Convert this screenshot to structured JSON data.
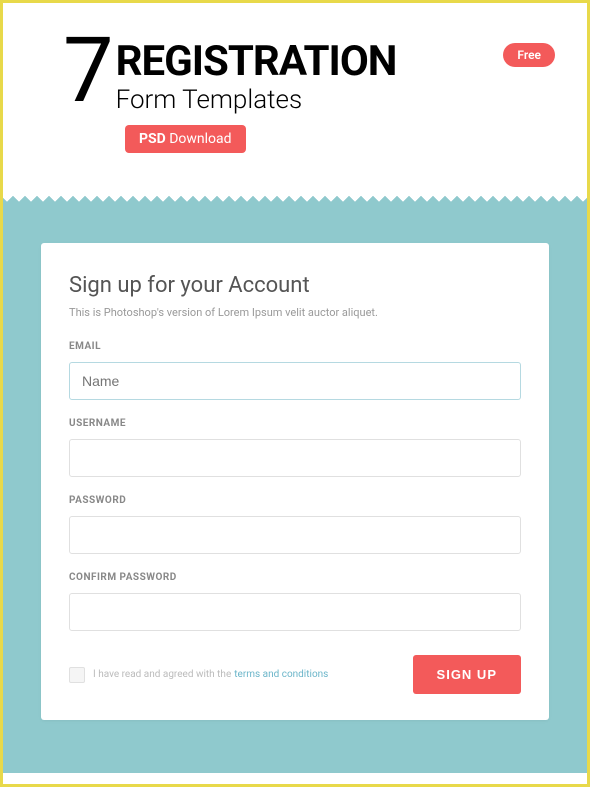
{
  "header": {
    "number": "7",
    "title": "REGISTRATION",
    "subtitle": "Form Templates",
    "free_badge": "Free",
    "psd_label_bold": "PSD",
    "psd_label_rest": " Download"
  },
  "form": {
    "title": "Sign up for your Account",
    "description": "This is Photoshop's version of Lorem Ipsum velit auctor aliquet.",
    "fields": {
      "email": {
        "label": "EMAIL",
        "placeholder": "Name"
      },
      "username": {
        "label": "USERNAME",
        "placeholder": ""
      },
      "password": {
        "label": "PASSWORD",
        "placeholder": ""
      },
      "confirm": {
        "label": "CONFIRM PASSWORD",
        "placeholder": ""
      }
    },
    "terms_text": "I have read and agreed with the",
    "terms_link": "terms and conditions",
    "signup_button": "SIGN UP"
  }
}
